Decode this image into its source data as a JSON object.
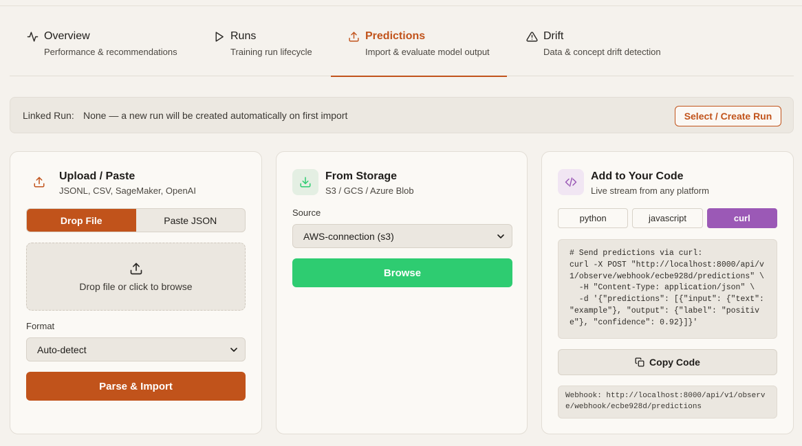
{
  "tabs": [
    {
      "title": "Overview",
      "subtitle": "Performance & recommendations",
      "icon": "activity-icon"
    },
    {
      "title": "Runs",
      "subtitle": "Training run lifecycle",
      "icon": "play-icon"
    },
    {
      "title": "Predictions",
      "subtitle": "Import & evaluate model output",
      "icon": "upload-icon",
      "active": true
    },
    {
      "title": "Drift",
      "subtitle": "Data & concept drift detection",
      "icon": "warning-icon"
    }
  ],
  "linked_run": {
    "label": "Linked Run:",
    "value": "None — a new run will be created automatically on first import",
    "button": "Select / Create Run"
  },
  "upload": {
    "title": "Upload / Paste",
    "subtitle": "JSONL, CSV, SageMaker, OpenAI",
    "modes": [
      "Drop File",
      "Paste JSON"
    ],
    "active_mode": "Drop File",
    "drop_text": "Drop file or click to browse",
    "format_label": "Format",
    "format_value": "Auto-detect",
    "import_button": "Parse & Import"
  },
  "storage": {
    "title": "From Storage",
    "subtitle": "S3 / GCS / Azure Blob",
    "source_label": "Source",
    "source_value": "AWS-connection (s3)",
    "browse_button": "Browse"
  },
  "code": {
    "title": "Add to Your Code",
    "subtitle": "Live stream from any platform",
    "languages": [
      "python",
      "javascript",
      "curl"
    ],
    "active_language": "curl",
    "snippet": "# Send predictions via curl:\ncurl -X POST \"http://localhost:8000/api/v\n1/observe/webhook/ecbe928d/predictions\" \\\n  -H \"Content-Type: application/json\" \\\n  -d '{\"predictions\": [{\"input\": {\"text\":\n\"example\"}, \"output\": {\"label\": \"positiv\ne\"}, \"confidence\": 0.92}]}'",
    "copy_button": "Copy Code",
    "webhook": "Webhook: http://localhost:8000/api/v1/observ\ne/webhook/ecbe928d/predictions"
  },
  "colors": {
    "accent": "#c1531b",
    "green": "#2ecc71",
    "purple": "#9b59b6",
    "background": "#f5f2ed"
  }
}
